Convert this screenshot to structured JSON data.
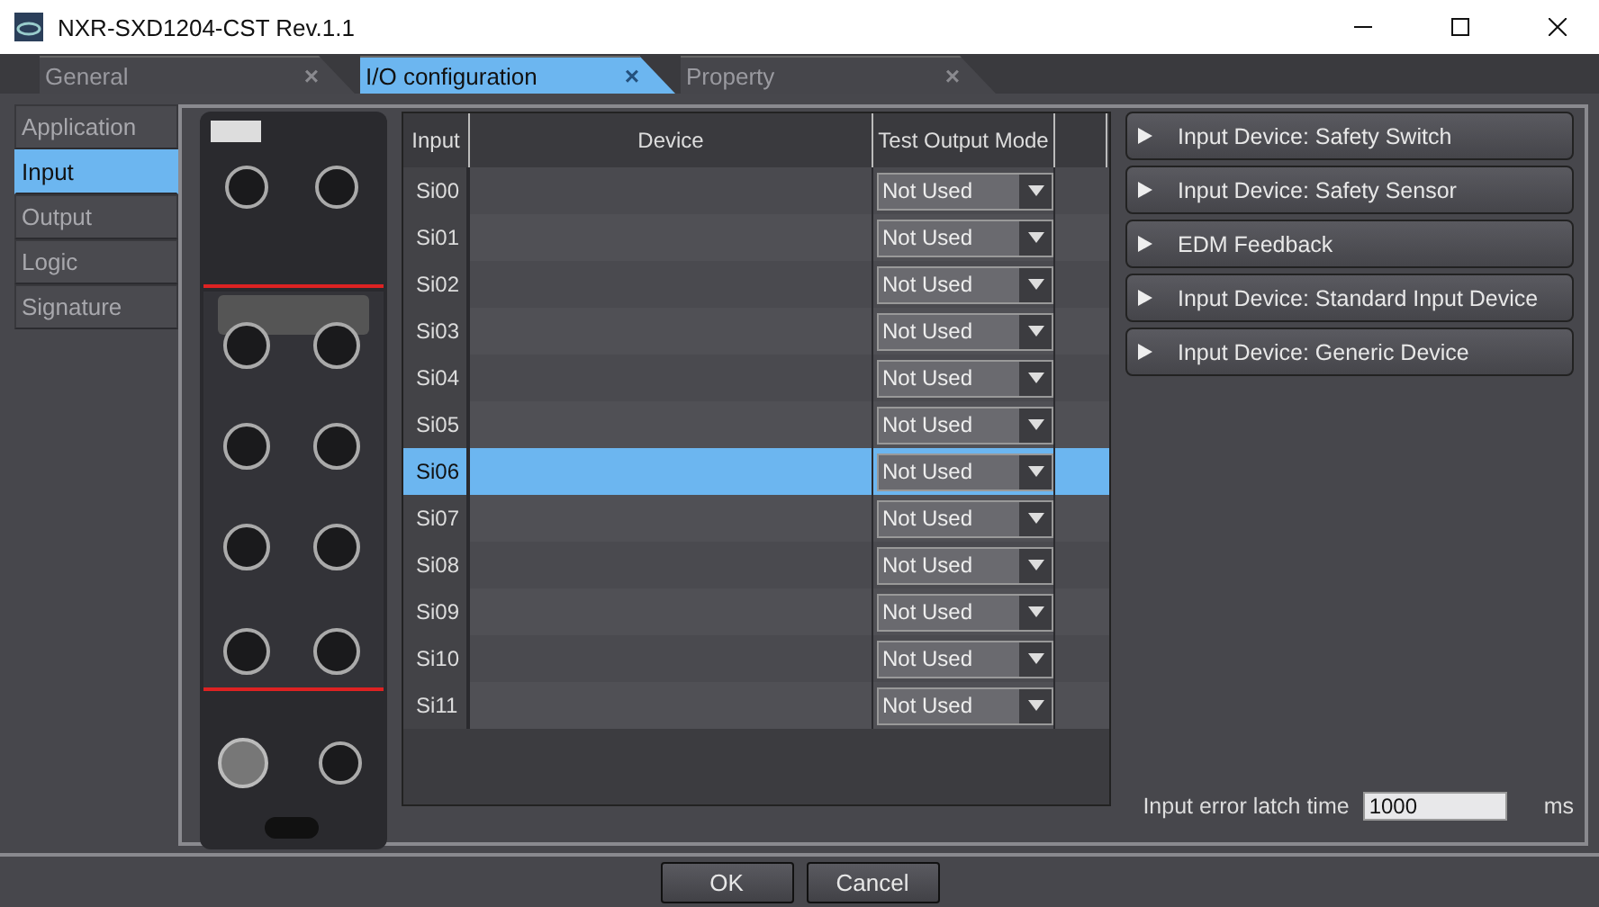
{
  "window": {
    "title": "NXR-SXD1204-CST Rev.1.1"
  },
  "tabs": [
    {
      "label": "General",
      "selected": false,
      "close": "×"
    },
    {
      "label": "I/O configuration",
      "selected": true,
      "close": "×"
    },
    {
      "label": "Property",
      "selected": false,
      "close": "×"
    }
  ],
  "sidebar": {
    "items": [
      {
        "label": "Application",
        "selected": false
      },
      {
        "label": "Input",
        "selected": true
      },
      {
        "label": "Output",
        "selected": false
      },
      {
        "label": "Logic",
        "selected": false
      },
      {
        "label": "Signature",
        "selected": false
      }
    ]
  },
  "device_image": {
    "kind": "picture"
  },
  "table": {
    "columns": [
      "Input",
      "Device",
      "Test Output Mode"
    ],
    "rows": [
      {
        "input": "Si00",
        "mode": "Not Used",
        "selected": false
      },
      {
        "input": "Si01",
        "mode": "Not Used",
        "selected": false
      },
      {
        "input": "Si02",
        "mode": "Not Used",
        "selected": false
      },
      {
        "input": "Si03",
        "mode": "Not Used",
        "selected": false
      },
      {
        "input": "Si04",
        "mode": "Not Used",
        "selected": false
      },
      {
        "input": "Si05",
        "mode": "Not Used",
        "selected": false
      },
      {
        "input": "Si06",
        "mode": "Not Used",
        "selected": true
      },
      {
        "input": "Si07",
        "mode": "Not Used",
        "selected": false
      },
      {
        "input": "Si08",
        "mode": "Not Used",
        "selected": false
      },
      {
        "input": "Si09",
        "mode": "Not Used",
        "selected": false
      },
      {
        "input": "Si10",
        "mode": "Not Used",
        "selected": false
      },
      {
        "input": "Si11",
        "mode": "Not Used",
        "selected": false
      }
    ]
  },
  "device_groups": [
    {
      "label": "Input Device: Safety Switch",
      "expanded": false
    },
    {
      "label": "Input Device: Safety Sensor",
      "expanded": false
    },
    {
      "label": "EDM Feedback",
      "expanded": false
    },
    {
      "label": "Input Device: Standard Input Device",
      "expanded": false
    },
    {
      "label": "Input Device: Generic Device",
      "expanded": false
    }
  ],
  "latch_time": {
    "label": "Input error latch time",
    "value": "1000",
    "unit": "ms"
  },
  "buttons": [
    "OK",
    "Cancel"
  ]
}
